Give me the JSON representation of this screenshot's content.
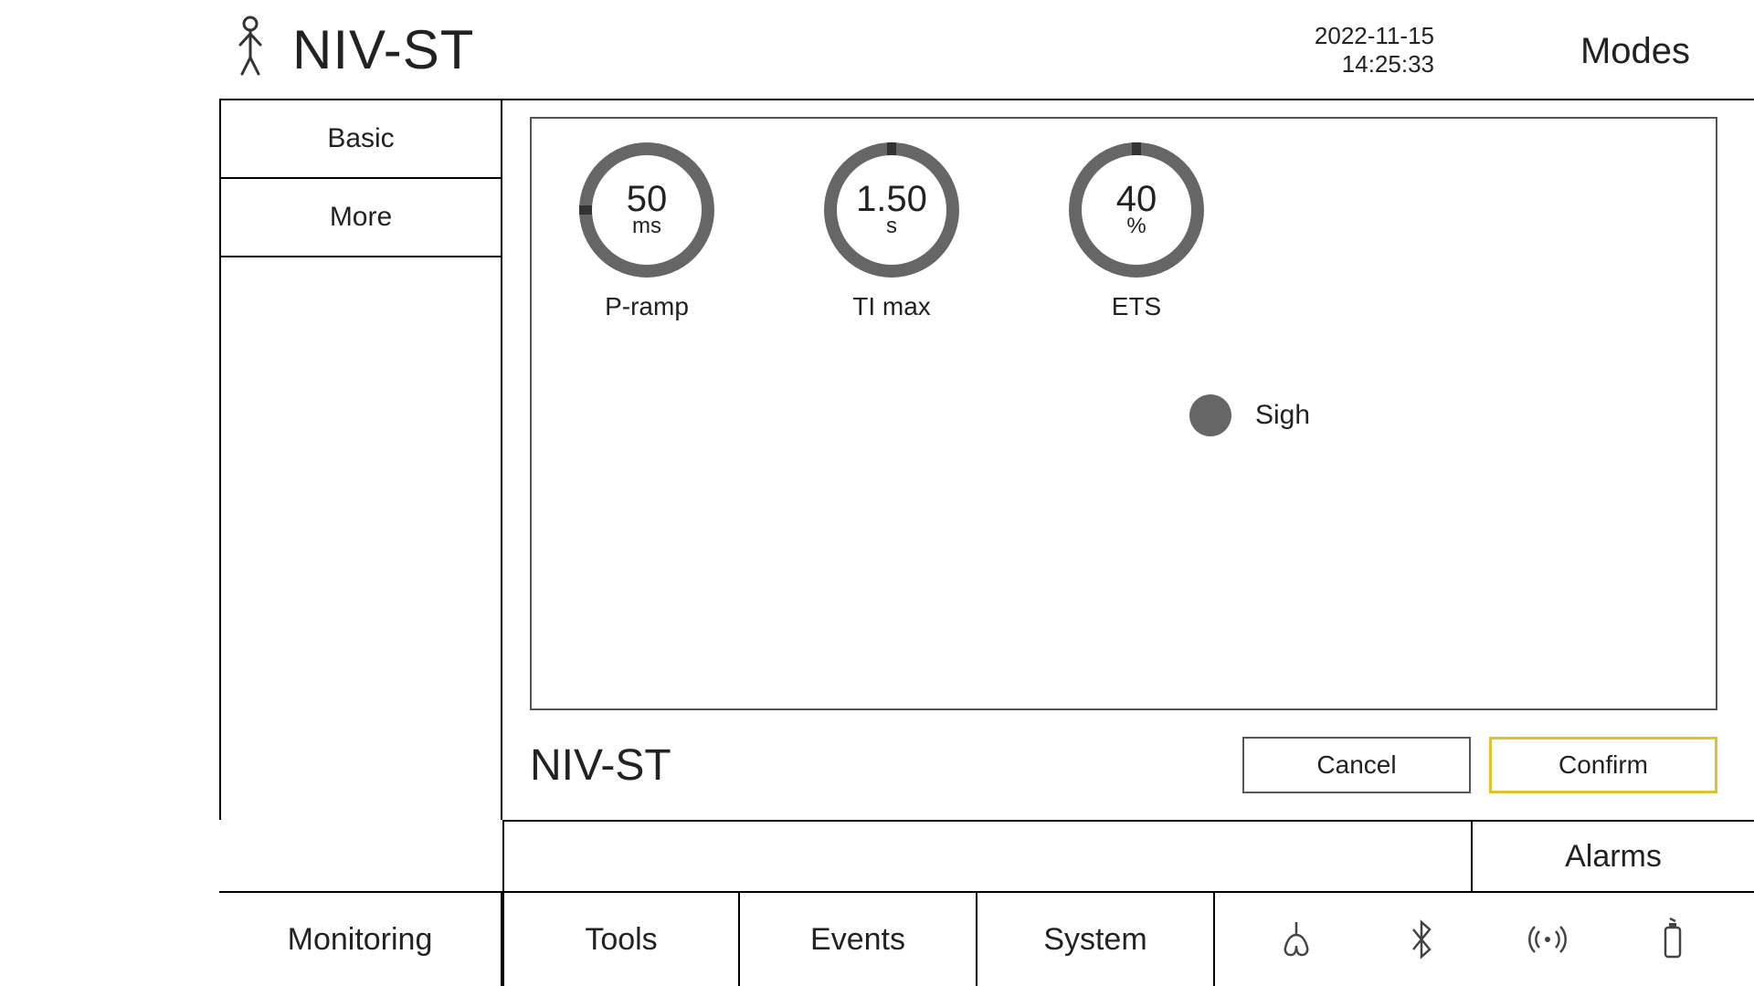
{
  "header": {
    "mode": "NIV-ST",
    "date": "2022-11-15",
    "time": "14:25:33",
    "modes_label": "Modes"
  },
  "tabs": {
    "basic": "Basic",
    "more": "More"
  },
  "dials": [
    {
      "value": "50",
      "unit": "ms",
      "label": "P-ramp"
    },
    {
      "value": "1.50",
      "unit": "s",
      "label": "TI max"
    },
    {
      "value": "40",
      "unit": "%",
      "label": "ETS"
    }
  ],
  "sigh": {
    "label": "Sigh",
    "active": false
  },
  "footer": {
    "mode_label": "NIV-ST",
    "cancel": "Cancel",
    "confirm": "Confirm"
  },
  "alarms_label": "Alarms",
  "nav": {
    "monitoring": "Monitoring",
    "tools": "Tools",
    "events": "Events",
    "system": "System"
  }
}
